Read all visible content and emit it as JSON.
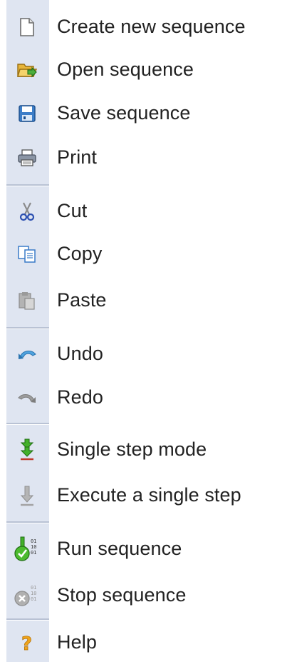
{
  "menu": {
    "items": [
      {
        "label": "Create new sequence",
        "icon": "new-document-icon",
        "enabled": true
      },
      {
        "label": "Open sequence",
        "icon": "open-folder-icon",
        "enabled": true
      },
      {
        "label": "Save sequence",
        "icon": "save-floppy-icon",
        "enabled": true
      },
      {
        "label": "Print",
        "icon": "printer-icon",
        "enabled": true
      },
      {
        "label": "Cut",
        "icon": "scissors-icon",
        "enabled": true
      },
      {
        "label": "Copy",
        "icon": "copy-icon",
        "enabled": true
      },
      {
        "label": "Paste",
        "icon": "paste-icon",
        "enabled": false
      },
      {
        "label": "Undo",
        "icon": "undo-icon",
        "enabled": true
      },
      {
        "label": "Redo",
        "icon": "redo-icon",
        "enabled": false
      },
      {
        "label": "Single step mode",
        "icon": "single-step-mode-icon",
        "enabled": true
      },
      {
        "label": "Execute a single step",
        "icon": "execute-step-icon",
        "enabled": false
      },
      {
        "label": "Run sequence",
        "icon": "run-sequence-icon",
        "enabled": true
      },
      {
        "label": "Stop sequence",
        "icon": "stop-sequence-icon",
        "enabled": false
      },
      {
        "label": "Help",
        "icon": "help-icon",
        "enabled": true
      }
    ]
  },
  "colors": {
    "gutter": "#dfe5f1",
    "separator": "#b9c2d4",
    "text": "#222222"
  }
}
